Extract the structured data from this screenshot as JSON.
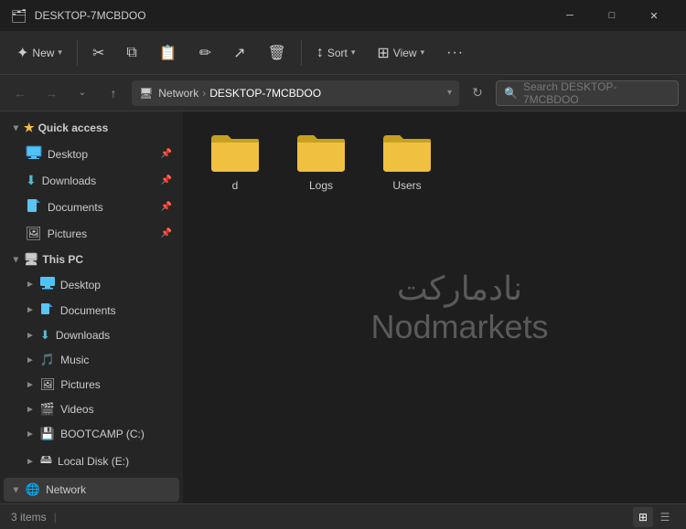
{
  "titleBar": {
    "title": "DESKTOP-7MCBDOO",
    "iconUnicode": "📁",
    "minimizeLabel": "─",
    "maximizeLabel": "□",
    "closeLabel": "✕"
  },
  "toolbar": {
    "newLabel": "New",
    "cutLabel": "Cut",
    "copyLabel": "Copy",
    "pasteLabel": "Paste",
    "renameLabel": "Rename",
    "shareLabel": "Share",
    "deleteLabel": "Delete",
    "sortLabel": "Sort",
    "viewLabel": "View",
    "moreLabel": "···"
  },
  "addressBar": {
    "backTooltip": "Back",
    "forwardTooltip": "Forward",
    "upTooltip": "Up",
    "breadcrumbs": [
      "Network",
      "DESKTOP-7MCBDOO"
    ],
    "searchPlaceholder": "Search DESKTOP-7MCBDOO",
    "refreshTooltip": "Refresh"
  },
  "sidebar": {
    "quickAccessLabel": "Quick access",
    "quickAccessItems": [
      {
        "label": "Desktop",
        "pinned": true
      },
      {
        "label": "Downloads",
        "pinned": true
      },
      {
        "label": "Documents",
        "pinned": true
      },
      {
        "label": "Pictures",
        "pinned": true
      }
    ],
    "thisPCLabel": "This PC",
    "thisPCItems": [
      {
        "label": "Desktop",
        "type": "folder"
      },
      {
        "label": "Documents",
        "type": "folder"
      },
      {
        "label": "Downloads",
        "type": "folder"
      },
      {
        "label": "Music",
        "type": "music"
      },
      {
        "label": "Pictures",
        "type": "pictures"
      },
      {
        "label": "Videos",
        "type": "video"
      },
      {
        "label": "BOOTCAMP (C:)",
        "type": "drive"
      },
      {
        "label": "Local Disk (E:)",
        "type": "drive"
      }
    ],
    "networkLabel": "Network",
    "networkActive": true
  },
  "fileArea": {
    "folders": [
      {
        "label": "d"
      },
      {
        "label": "Logs"
      },
      {
        "label": "Users"
      }
    ],
    "watermark": {
      "persian": "نادمارکت",
      "english": "Nodmarkets"
    }
  },
  "statusBar": {
    "itemCount": "3 items",
    "separator": "|"
  }
}
